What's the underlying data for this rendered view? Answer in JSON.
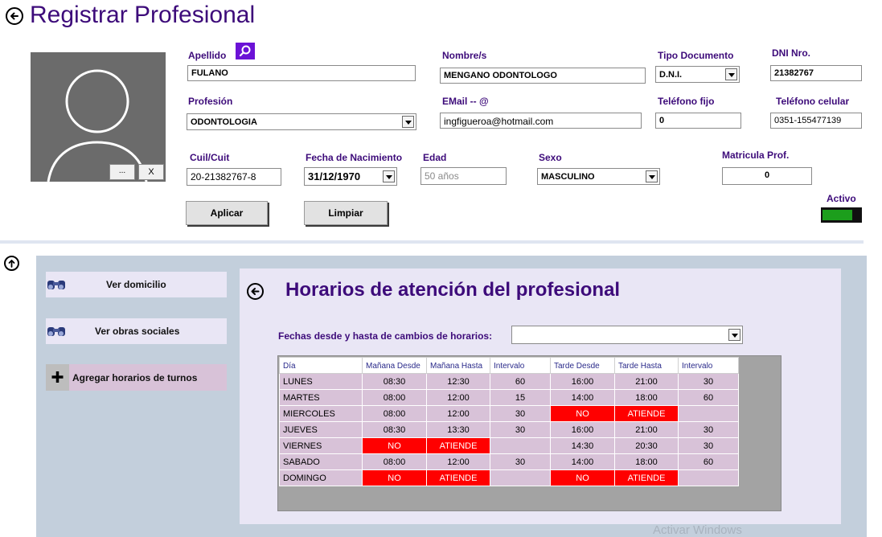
{
  "header": {
    "title": "Registrar Profesional"
  },
  "photo": {
    "browse_label": "...",
    "clear_label": "X"
  },
  "form": {
    "apellido": {
      "label": "Apellido",
      "value": "FULANO"
    },
    "nombre": {
      "label": "Nombre/s",
      "value": "MENGANO ODONTOLOGO"
    },
    "tipo_documento": {
      "label": "Tipo Documento",
      "value": "D.N.I."
    },
    "dni": {
      "label": "DNI Nro.",
      "value": "21382767"
    },
    "profesion": {
      "label": "Profesión",
      "value": "ODONTOLOGIA"
    },
    "email": {
      "label": "EMail -- @",
      "value": "ingfigueroa@hotmail.com"
    },
    "telefono_fijo": {
      "label": "Teléfono fijo",
      "value": "0"
    },
    "telefono_celular": {
      "label": "Teléfono celular",
      "value": "0351-155477139"
    },
    "cuil": {
      "label": "Cuil/Cuit",
      "value": "20-21382767-8"
    },
    "fecha_nacimiento": {
      "label": "Fecha de Nacimiento",
      "value": "31/12/1970"
    },
    "edad": {
      "label": "Edad",
      "value": "50 años"
    },
    "sexo": {
      "label": "Sexo",
      "value": "MASCULINO"
    },
    "matricula": {
      "label": "Matricula Prof.",
      "value": "0"
    },
    "activo": {
      "label": "Activo"
    }
  },
  "buttons": {
    "aplicar": "Aplicar",
    "limpiar": "Limpiar"
  },
  "sidebar": {
    "items": [
      {
        "label": "Ver domicilio"
      },
      {
        "label": "Ver obras sociales"
      },
      {
        "label": "Agregar horarios de turnos"
      }
    ]
  },
  "horarios": {
    "title": "Horarios de atención del profesional",
    "fechas_label": "Fechas desde y hasta de cambios de horarios:",
    "fechas_value": "",
    "columns": [
      "Día",
      "Mañana Desde",
      "Mañana Hasta",
      "Intervalo",
      "Tarde Desde",
      "Tarde Hasta",
      "Intervalo"
    ],
    "rows": [
      [
        "LUNES",
        "08:30",
        "12:30",
        "60",
        "16:00",
        "21:00",
        "30"
      ],
      [
        "MARTES",
        "08:00",
        "12:00",
        "15",
        "14:00",
        "18:00",
        "60"
      ],
      [
        "MIERCOLES",
        "08:00",
        "12:00",
        "30",
        "NO",
        "ATIENDE",
        ""
      ],
      [
        "JUEVES",
        "08:30",
        "13:30",
        "30",
        "16:00",
        "21:00",
        "30"
      ],
      [
        "VIERNES",
        "NO",
        "ATIENDE",
        "",
        "14:30",
        "20:30",
        "30"
      ],
      [
        "SABADO",
        "08:00",
        "12:00",
        "30",
        "14:00",
        "18:00",
        "60"
      ],
      [
        "DOMINGO",
        "NO",
        "ATIENDE",
        "",
        "NO",
        "ATIENDE",
        ""
      ]
    ]
  },
  "watermark": "Activar Windows",
  "colors": {
    "accent": "#3d0b7a",
    "red": "#ff0000",
    "cell": "#d8c2d8",
    "panel": "#c3cfdc",
    "active": "#1c9e1c"
  }
}
